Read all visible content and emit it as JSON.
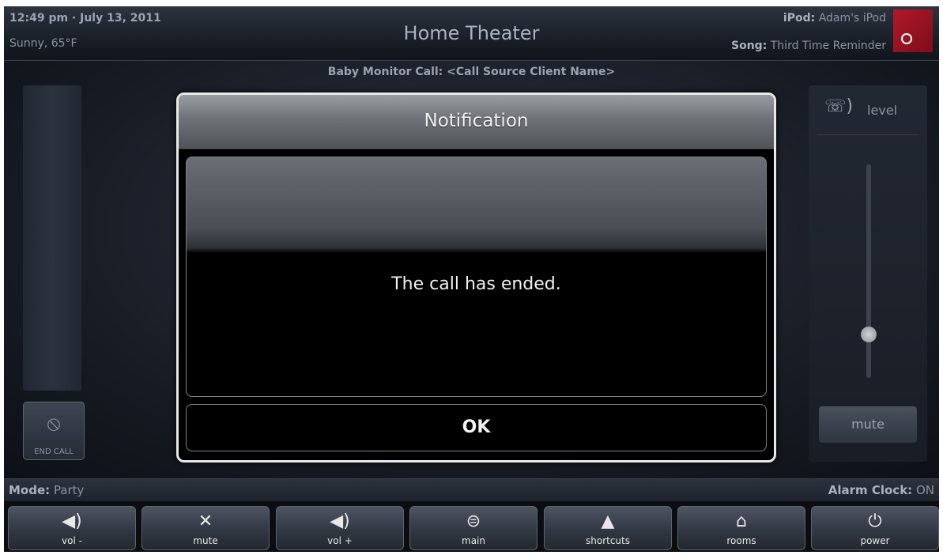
{
  "header": {
    "datetime": "12:49 pm · July 13, 2011",
    "weather": "Sunny, 65°F",
    "title": "Home Theater",
    "ipod_label": "iPod:",
    "ipod_value": "Adam's iPod",
    "song_label": "Song:",
    "song_value": "Third Time Reminder"
  },
  "call": {
    "label": "Baby Monitor Call: <Call Source Client Name>",
    "end_call_label": "END CALL",
    "end_call_icon": "mute-phone-icon"
  },
  "volume_panel": {
    "icon": "phone-speaker-icon",
    "level_label": "level",
    "level_value": 0.2,
    "mute_label": "mute"
  },
  "status": {
    "mode_label": "Mode:",
    "mode_value": "Party",
    "alarm_label": "Alarm Clock:",
    "alarm_value": "ON"
  },
  "bottom_bar": [
    {
      "label": "vol -",
      "icon": "speaker-icon",
      "glyph": "◀)"
    },
    {
      "label": "mute",
      "icon": "mute-icon",
      "glyph": "✕"
    },
    {
      "label": "vol +",
      "icon": "speaker-icon",
      "glyph": "◀)"
    },
    {
      "label": "main",
      "icon": "grid-icon",
      "glyph": "⊜"
    },
    {
      "label": "shortcuts",
      "icon": "shortcuts-icon",
      "glyph": "▲"
    },
    {
      "label": "rooms",
      "icon": "house-icon",
      "glyph": "⌂"
    },
    {
      "label": "power",
      "icon": "power-icon",
      "glyph": "⏻"
    }
  ],
  "dialog": {
    "title": "Notification",
    "message": "The call has ended.",
    "ok_label": "OK"
  }
}
